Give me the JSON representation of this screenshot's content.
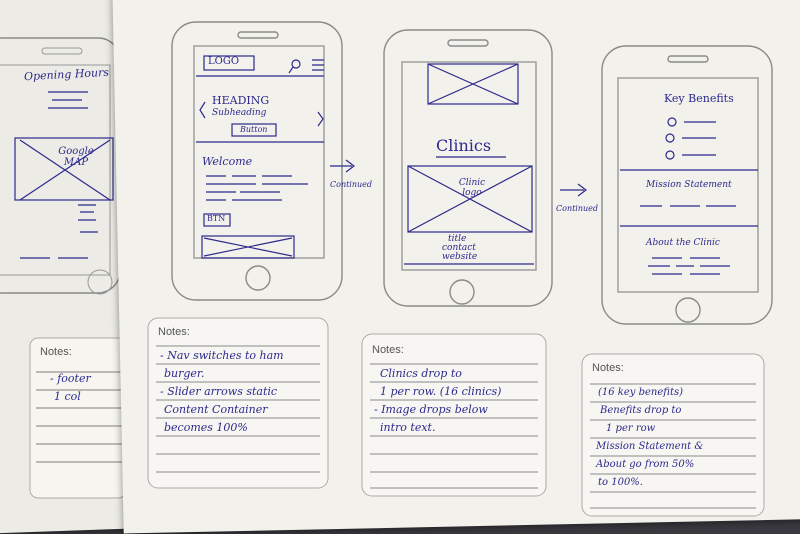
{
  "left_partial": {
    "opening_hours": "Opening Hours",
    "google_map": "Google MAP",
    "notes_label": "Notes:",
    "notes_lines": [
      "- footer",
      "1 col"
    ]
  },
  "phone1": {
    "logo": "LOGO",
    "heading": "HEADING",
    "subheading": "Subheading",
    "button": "Button",
    "welcome": "Welcome",
    "btn": "BTN",
    "notes_label": "Notes:",
    "notes_lines": [
      "- Nav switches to ham",
      "burger.",
      "- Slider arrows static",
      "Content Container",
      "becomes 100%"
    ]
  },
  "arrow1": "Continued",
  "phone2": {
    "clinics": "Clinics",
    "clinic_logo": "Clinic logo",
    "title": "title",
    "contact": "contact",
    "website": "website",
    "notes_label": "Notes:",
    "notes_lines": [
      "Clinics drop to",
      "1 per row. (16 clinics)",
      "- Image drops below",
      "intro text."
    ]
  },
  "arrow2": "Continued",
  "phone3": {
    "key_benefits": "Key Benefits",
    "mission": "Mission Statement",
    "about": "About the Clinic",
    "notes_label": "Notes:",
    "notes_lines": [
      "(16 key benefits)",
      "Benefits drop to",
      "1 per row",
      "Mission Statement &",
      "About go from 50%",
      "to 100%."
    ]
  }
}
